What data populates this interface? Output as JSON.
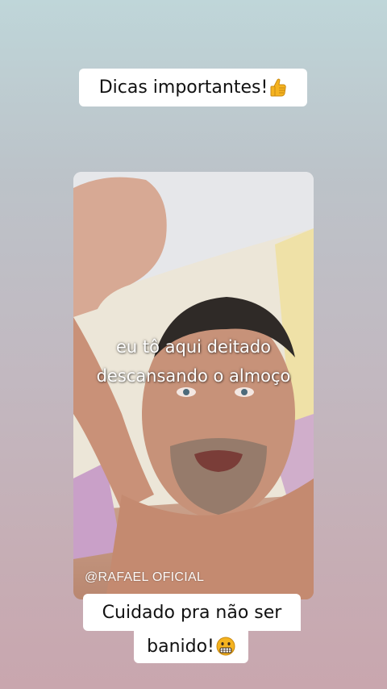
{
  "story": {
    "top_caption": "Dicas importantes!",
    "top_caption_emoji": "thumbs-up-icon",
    "subtitle_line1": "eu tô aqui deitado",
    "subtitle_line2": "descansando o almoço",
    "watermark": "@RAFAEL OFICIAL",
    "bottom_caption_line1": "Cuidado pra não ser",
    "bottom_caption_line2": "banido!",
    "bottom_caption_emoji": "grimacing-face-icon"
  },
  "colors": {
    "caption_bg": "#ffffff",
    "caption_text": "#111111",
    "subtitle_text": "#ffffff",
    "emoji_yellow": "#f5b31f"
  }
}
